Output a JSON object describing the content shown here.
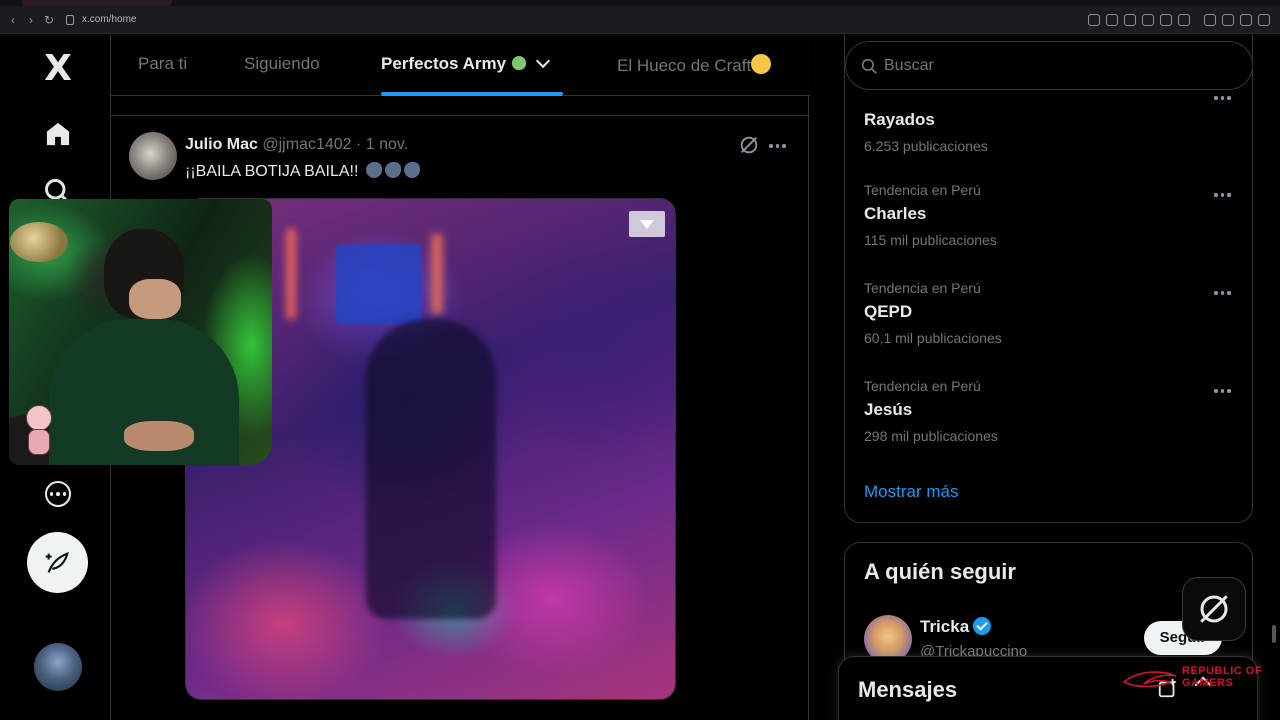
{
  "browser": {
    "url": "x.com/home"
  },
  "nav": {
    "logo": "X",
    "icons": [
      "home-icon",
      "search-icon",
      "more-icon",
      "compose-icon"
    ]
  },
  "main": {
    "tabs": [
      {
        "label": "Para ti"
      },
      {
        "label": "Siguiendo"
      },
      {
        "label": "Perfectos Army"
      },
      {
        "label": "El Hueco de Craft"
      }
    ],
    "active_tab": "Perfectos Army"
  },
  "tweet": {
    "name": "Julio Mac",
    "handle": "@jjmac1402",
    "separator": "·",
    "date": "1 nov.",
    "text": "¡¡BAILA BOTIJA BAILA!!"
  },
  "search": {
    "placeholder": "Buscar"
  },
  "trends": {
    "items": [
      {
        "category": "",
        "name": "Rayados",
        "count": "6.253 publicaciones"
      },
      {
        "category": "Tendencia en Perú",
        "name": "Charles",
        "count": "115 mil publicaciones"
      },
      {
        "category": "Tendencia en Perú",
        "name": "QEPD",
        "count": "60,1 mil publicaciones"
      },
      {
        "category": "Tendencia en Perú",
        "name": "Jesús",
        "count": "298 mil publicaciones"
      }
    ],
    "show_more": "Mostrar más"
  },
  "who_to_follow": {
    "title": "A quién seguir",
    "users": [
      {
        "name": "Tricka",
        "handle": "@Trickapuccino",
        "button": "Seguir"
      }
    ]
  },
  "messages": {
    "title": "Mensajes"
  },
  "overlay": {
    "rog_text_line1": "REPUBLIC OF",
    "rog_text_line2": "GAMERS"
  },
  "colors": {
    "accent": "#1d9bf0",
    "background": "#000000",
    "text_primary": "#e7e9ea",
    "text_secondary": "#71767b"
  }
}
